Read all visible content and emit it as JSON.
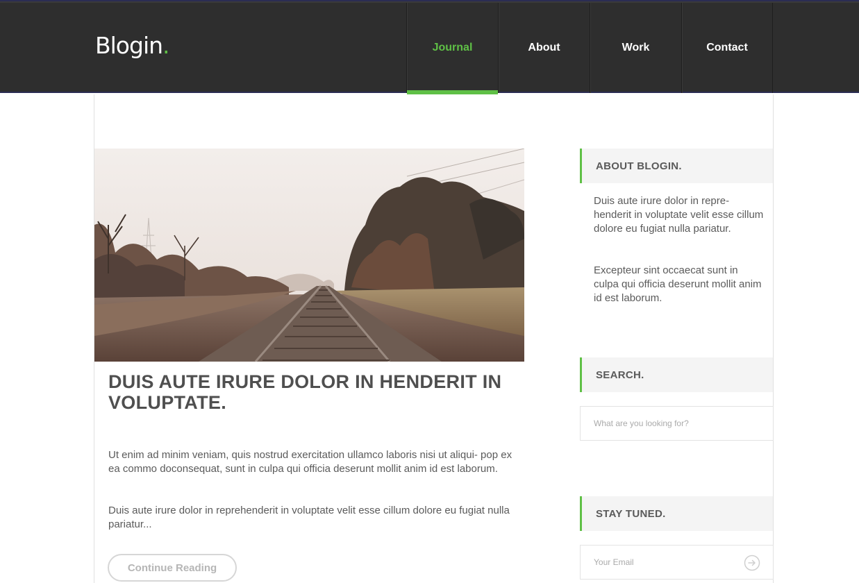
{
  "header": {
    "logo_text": "Blogin",
    "logo_dot": ".",
    "nav": [
      {
        "label": "Journal",
        "active": true
      },
      {
        "label": "About",
        "active": false
      },
      {
        "label": "Work",
        "active": false
      },
      {
        "label": "Contact",
        "active": false
      }
    ]
  },
  "post": {
    "image_icon": "railway-photo",
    "title": "DUIS AUTE IRURE DOLOR IN HENDERIT IN VOLUPTATE.",
    "paragraphs": [
      "Ut enim ad minim veniam, quis nostrud exercitation ullamco laboris nisi ut aliqui- pop ex ea commo doconsequat, sunt in culpa qui officia deserunt mollit anim id est laborum.",
      "Duis aute irure dolor in reprehenderit in voluptate velit esse cillum dolore eu fugiat nulla pariatur..."
    ],
    "continue_label": "Continue Reading"
  },
  "sidebar": {
    "about": {
      "title": "ABOUT BLOGIN.",
      "paragraphs": [
        "Duis aute irure dolor in repre- henderit in voluptate velit esse cillum dolore eu fugiat nulla pariatur.",
        "Excepteur sint occaecat sunt in culpa qui officia deserunt mollit anim id est laborum."
      ]
    },
    "search": {
      "title": "SEARCH.",
      "placeholder": "What are you looking for?"
    },
    "newsletter": {
      "title": "STAY TUNED.",
      "placeholder": "Your Email",
      "submit_icon": "arrow-circle-right-icon"
    }
  },
  "colors": {
    "accent": "#5fc046",
    "header_bg": "#2e2e2e",
    "widget_bg": "#f4f4f4"
  }
}
